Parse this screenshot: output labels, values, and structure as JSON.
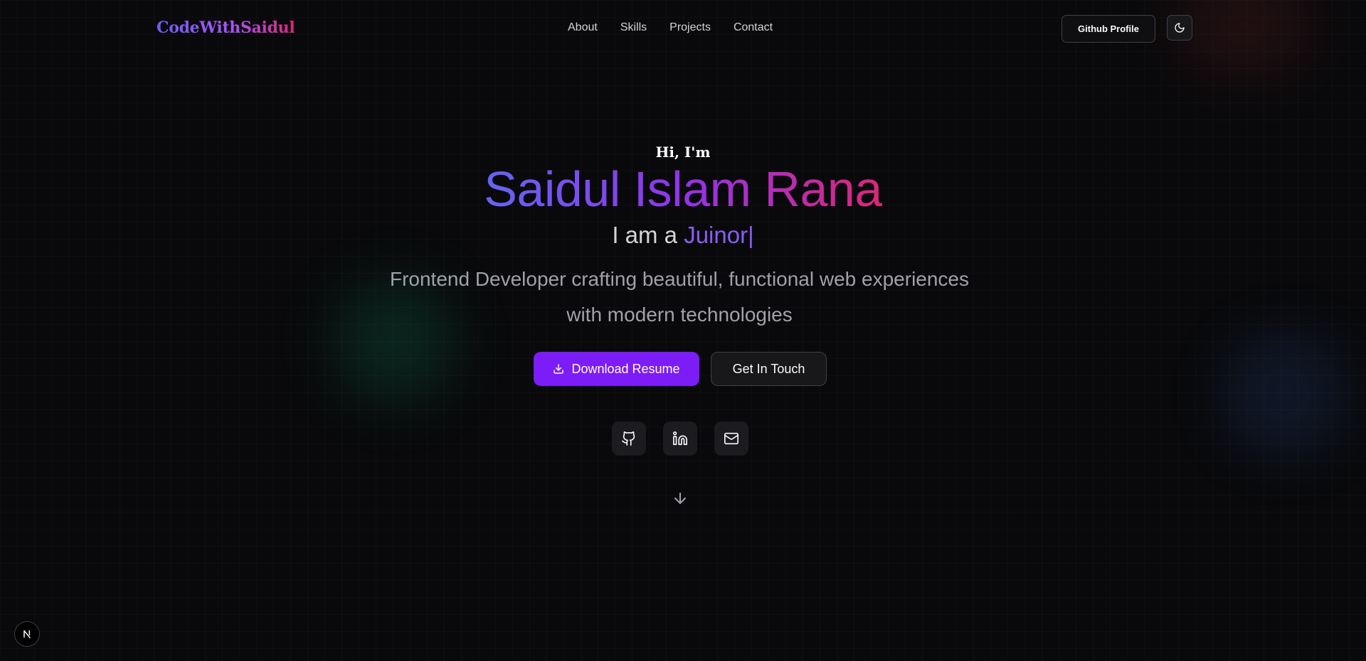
{
  "header": {
    "logo": "CodeWithSaidul",
    "nav": [
      "About",
      "Skills",
      "Projects",
      "Contact"
    ],
    "github_label": "Github Profile"
  },
  "hero": {
    "greeting": "Hi, I'm",
    "name": "Saidul Islam Rana",
    "role_prefix": "I am a",
    "role_typed": "Juinor",
    "role_cursor": "|",
    "description": "Frontend Developer crafting beautiful, functional web experiences with modern technologies",
    "primary_button": "Download Resume",
    "secondary_button": "Get In Touch"
  },
  "icons": {
    "theme": "moon-icon",
    "download": "download-icon",
    "socials": [
      "github-icon",
      "linkedin-icon",
      "mail-icon"
    ],
    "scroll": "arrow-down-icon",
    "dev_badge": "nextjs-icon"
  },
  "colors": {
    "accent": "#7c1cf7",
    "gradient_start": "#6366f1",
    "gradient_mid": "#9333ea",
    "gradient_end": "#db2777",
    "background": "#09090b"
  }
}
